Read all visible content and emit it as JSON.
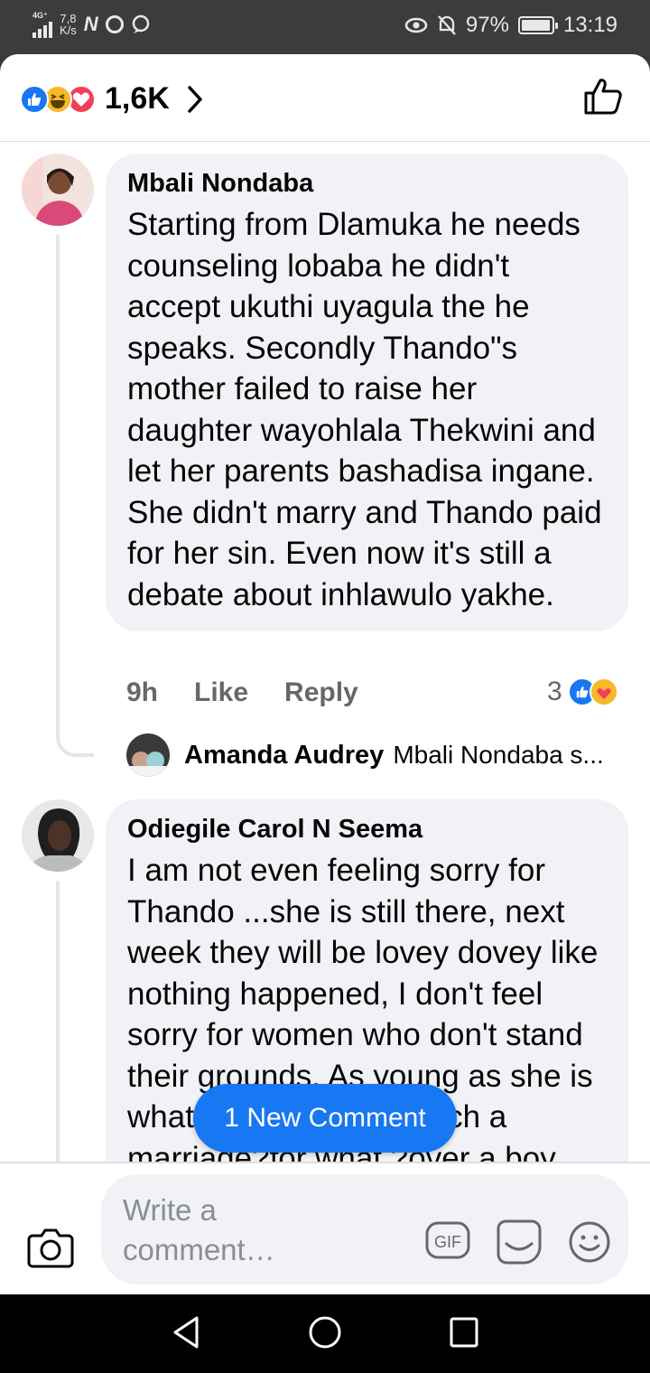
{
  "status_bar": {
    "network": "4G⁺",
    "speed_value": "7,8",
    "speed_unit": "K/s",
    "battery": "97%",
    "battery_level": 0.97,
    "time": "13:19"
  },
  "header": {
    "reaction_count": "1,6K"
  },
  "comments": [
    {
      "author": "Mbali Nondaba",
      "text": "Starting from Dlamuka he needs counseling lobaba he didn't accept ukuthi uyagula the he speaks. Secondly Thando\"s mother failed to raise her daughter wayohlala Thekwini and let her parents bashadisa ingane. She didn't marry and Thando paid for her sin. Even now it's still a debate about inhlawulo yakhe.",
      "time": "9h",
      "like_label": "Like",
      "reply_label": "Reply",
      "reaction_count": "3",
      "reply": {
        "author": "Amanda Audrey",
        "preview": "Mbali Nondaba s..."
      }
    },
    {
      "author": "Odiegile Carol N Seema",
      "text": "I am not even feeling sorry for Thando ...she is still there, next week they will be lovey dovey like nothing happened, I don't feel sorry for women who don't stand their grounds. As young as she is what is she doing in such a marriage?for what ?over a boy"
    }
  ],
  "new_comment_pill": "1 New Comment",
  "composer": {
    "placeholder": "Write a comment…",
    "gif_label": "GIF"
  },
  "colors": {
    "accent": "#1877f2",
    "bubble": "#f0f2f5",
    "secondary_text": "#65676b"
  }
}
